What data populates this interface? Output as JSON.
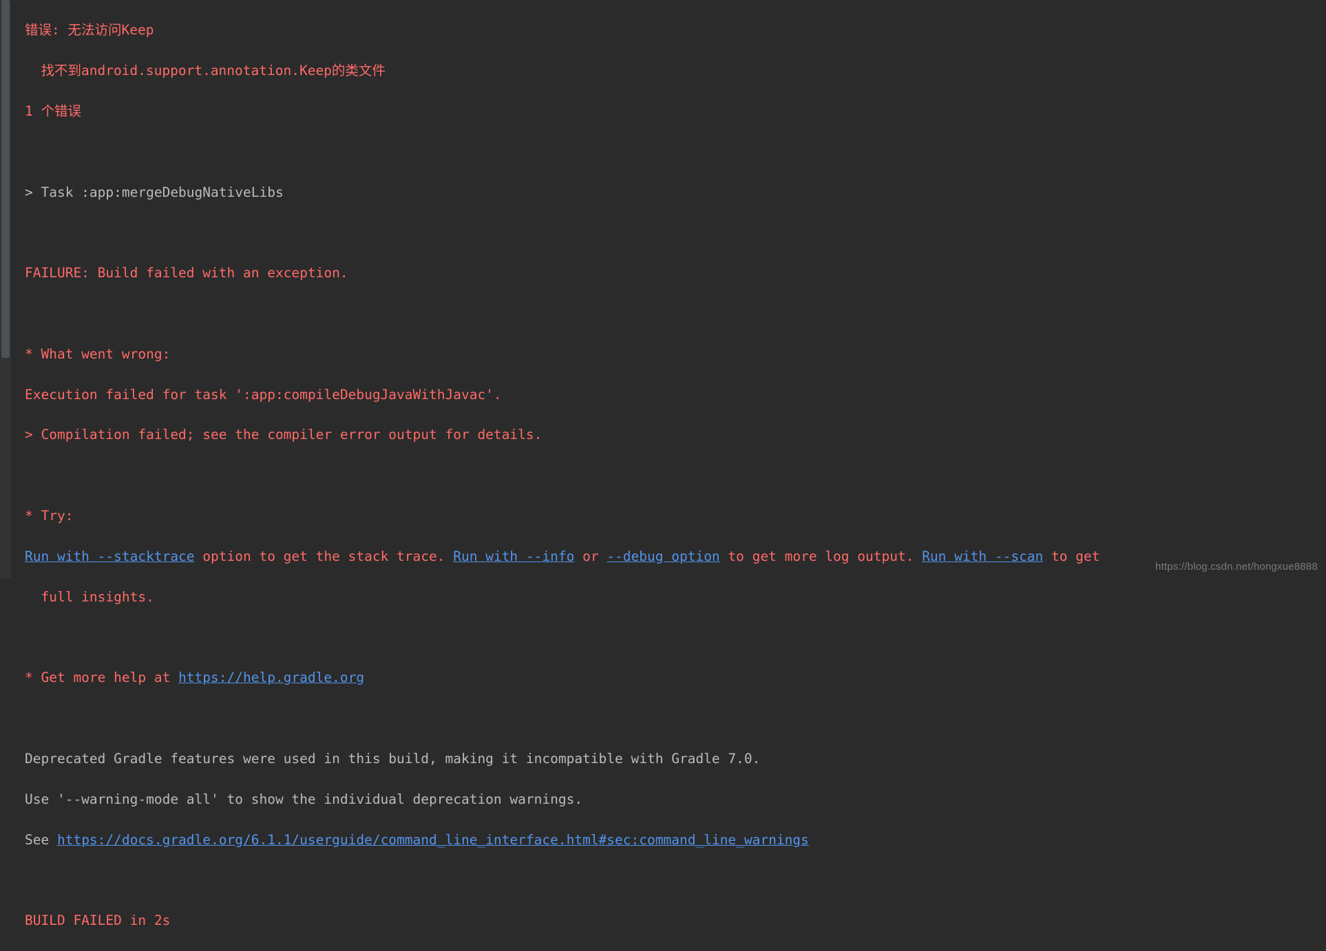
{
  "colors": {
    "background": "#2b2b2b",
    "error": "#ff6b68",
    "text": "#bbbbbb",
    "link": "#5394ec"
  },
  "lines": {
    "l01": "错误: 无法访问Keep",
    "l02": "  找不到android.support.annotation.Keep的类文件",
    "l03": "1 个错误",
    "l04": "> Task :app:mergeDebugNativeLibs",
    "l05": "FAILURE: Build failed with an exception.",
    "l06": "* What went wrong:",
    "l07": "Execution failed for task ':app:compileDebugJavaWithJavac'.",
    "l08": "> Compilation failed; see the compiler error output for details.",
    "l09": "* Try:",
    "l10a": "Run with --stacktrace",
    "l10b": " option to get the stack trace. ",
    "l10c": "Run with --info",
    "l10d": " or ",
    "l10e": "--debug option",
    "l10f": " to get more log output. ",
    "l10g": "Run with --scan",
    "l10h": " to get",
    "l11": "  full insights.",
    "l12a": "* Get more help at ",
    "l12b": "https://help.gradle.org",
    "l13": "Deprecated Gradle features were used in this build, making it incompatible with Gradle 7.0.",
    "l14": "Use '--warning-mode all' to show the individual deprecation warnings.",
    "l15a": "See ",
    "l15b": "https://docs.gradle.org/6.1.1/userguide/command_line_interface.html#sec:command_line_warnings",
    "l16": "BUILD FAILED in 2s"
  },
  "watermark": "https://blog.csdn.net/hongxue8888"
}
